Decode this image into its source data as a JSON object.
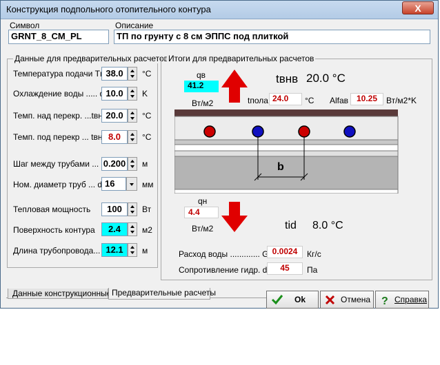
{
  "window": {
    "title": "Конструкция подпольного отопительного контура",
    "close_glyph": "X"
  },
  "symbol": {
    "label": "Символ",
    "value": "GRNT_8_CM_PL"
  },
  "description": {
    "label": "Описание",
    "value": "ТП по грунту с 8 см ЭППС под плиткой"
  },
  "left_group": {
    "title": "Данные для предварительных расчетов",
    "rows": [
      {
        "label": "Температура подачи  Tп",
        "value": "38.0",
        "unit": "°C"
      },
      {
        "label": "Охлаждение воды ..... dT",
        "value": "10.0",
        "unit": "K"
      },
      {
        "label": "Темп. над перекр. ...tвнв",
        "value": "20.0",
        "unit": "°C"
      },
      {
        "label": "Темп. под перекр ... tвнн",
        "value": "8.0",
        "unit": "°C"
      },
      {
        "label": "Шаг между трубами ... b",
        "value": "0.200",
        "unit": "м"
      },
      {
        "label": "Ном. диаметр труб ... dn",
        "value": "16",
        "unit": "мм"
      },
      {
        "label": "Тепловая мощность",
        "value": "100",
        "unit": "Вт"
      },
      {
        "label": "Поверхность контура",
        "value": "2.4",
        "unit": "м2"
      },
      {
        "label": "Длина трубопровода... L",
        "value": "12.1",
        "unit": "м"
      }
    ]
  },
  "right_group": {
    "title": "Итоги для предварительных расчетов",
    "qv_label": "qв",
    "qv_value": "41.2",
    "qv_unit": "Вт/м2",
    "tvnv_label": "tвнв",
    "tvnv_value": "20.0 °C",
    "tpola_label": "tпола",
    "tpola_value": "24.0",
    "tpola_unit": "°C",
    "alfa_label": "Alfaв",
    "alfa_value": "10.25",
    "alfa_unit": "Вт/м2*K",
    "b_label": "b",
    "qn_label": "qн",
    "qn_value": "4.4",
    "qn_unit": "Вт/м2",
    "tid_label": "tid",
    "tid_value": "8.0 °C",
    "flow_label": "Расход воды ............. G",
    "flow_value": "0.0024",
    "flow_unit": "Кг/с",
    "resist_label": "Сопротивление гидр. dP",
    "resist_value": "45",
    "resist_unit": "Па"
  },
  "tabs": [
    {
      "label": "Данные конструкционные"
    },
    {
      "label": "Предварительные расчеты"
    }
  ],
  "buttons": {
    "ok": "Ok",
    "cancel": "Отмена",
    "help": "Справка"
  },
  "colors": {
    "arrow": "#e00000",
    "highlight": "#00ffff",
    "pipe_red": "#cc0000",
    "pipe_blue": "#1010c0",
    "value_red": "#c00000"
  }
}
